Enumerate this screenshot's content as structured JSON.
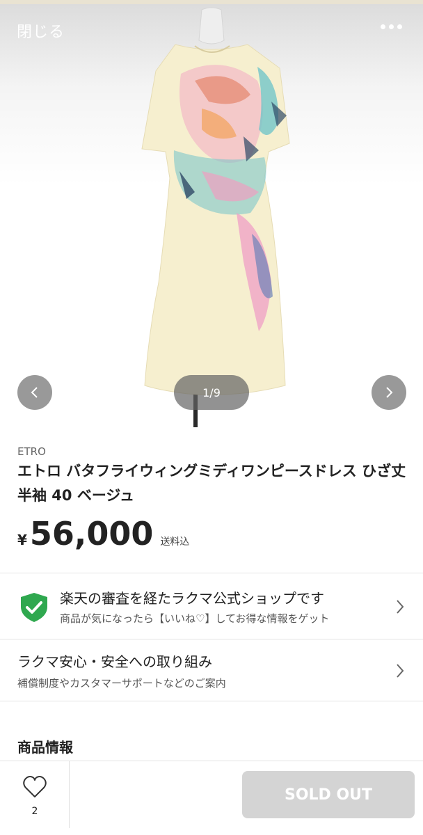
{
  "header": {
    "close_label": "閉じる",
    "more_icon": "more-horizontal-icon"
  },
  "gallery": {
    "current": 1,
    "total": 9,
    "counter_text": "1/9",
    "prev_icon": "chevron-left-icon",
    "next_icon": "chevron-right-icon"
  },
  "product": {
    "brand": "ETRO",
    "title": "エトロ バタフライウィングミディワンピースドレス ひざ丈 半袖 40 ベージュ",
    "price_currency": "¥",
    "price": "56,000",
    "shipping": "送料込"
  },
  "rows": [
    {
      "icon": "shield-check-icon",
      "title": "楽天の審査を経たラクマ公式ショップです",
      "subtitle": "商品が気になったら【いいね♡】してお得な情報をゲット"
    },
    {
      "title": "ラクマ安心・安全への取り組み",
      "subtitle": "補償制度やカスタマーサポートなどのご案内"
    }
  ],
  "section": {
    "heading": "商品情報"
  },
  "bottom_bar": {
    "like_icon": "heart-icon",
    "like_count": "2",
    "buy_label": "SOLD OUT"
  },
  "colors": {
    "shield_green": "#2fa84f",
    "sold_out_bg": "#d4d4d4",
    "dress_base": "#f6efcf"
  }
}
